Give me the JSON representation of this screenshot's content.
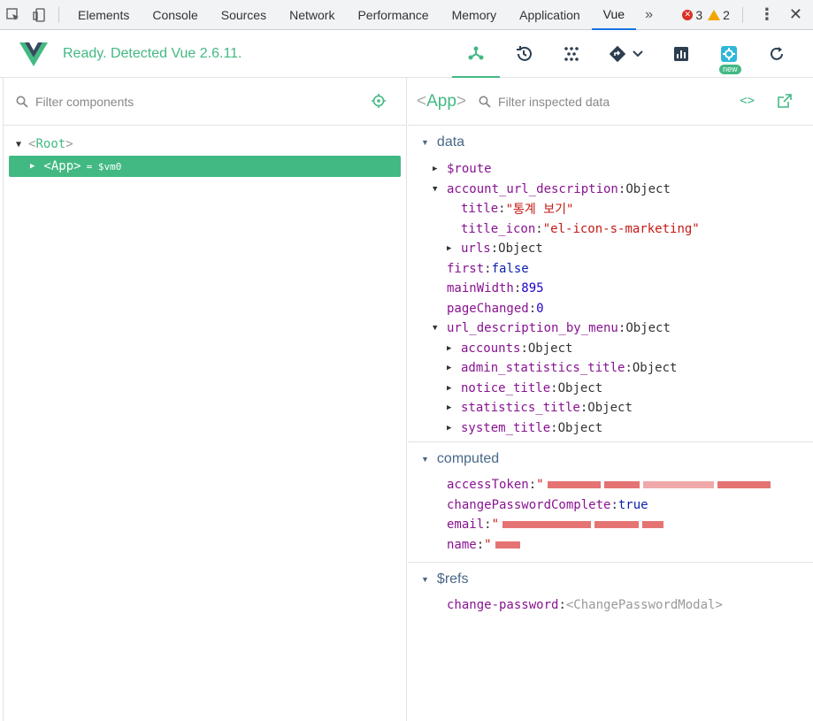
{
  "devtools": {
    "tabs": [
      "Elements",
      "Console",
      "Sources",
      "Network",
      "Performance",
      "Memory",
      "Application",
      "Vue"
    ],
    "active_tab": "Vue",
    "more": "»",
    "errors": "3",
    "warnings": "2"
  },
  "vue_header": {
    "status": "Ready. Detected Vue 2.6.11.",
    "new_badge": "new",
    "accent": "#42b983"
  },
  "left": {
    "filter_placeholder": "Filter components",
    "root_label": "Root",
    "app_label": "App",
    "app_vm": "= $vm0"
  },
  "right": {
    "component": "App",
    "filter_placeholder": "Filter inspected data",
    "code_icon": "<>",
    "sections": {
      "data": {
        "title": "data",
        "rows": [
          {
            "key": "$route",
            "value": ""
          },
          {
            "key": "account_url_description",
            "value": "Object"
          },
          {
            "key": "title",
            "value": "\"통계 보기\""
          },
          {
            "key": "title_icon",
            "value": "\"el-icon-s-marketing\""
          },
          {
            "key": "urls",
            "value": "Object"
          },
          {
            "key": "first",
            "value": "false"
          },
          {
            "key": "mainWidth",
            "value": "895"
          },
          {
            "key": "pageChanged",
            "value": "0"
          },
          {
            "key": "url_description_by_menu",
            "value": "Object"
          },
          {
            "key": "accounts",
            "value": "Object"
          },
          {
            "key": "admin_statistics_title",
            "value": "Object"
          },
          {
            "key": "notice_title",
            "value": "Object"
          },
          {
            "key": "statistics_title",
            "value": "Object"
          },
          {
            "key": "system_title",
            "value": "Object"
          }
        ]
      },
      "computed": {
        "title": "computed",
        "rows": [
          {
            "key": "accessToken",
            "value": "\""
          },
          {
            "key": "changePasswordComplete",
            "value": "true"
          },
          {
            "key": "email",
            "value": "\""
          },
          {
            "key": "name",
            "value": "\""
          }
        ]
      },
      "refs": {
        "title": "$refs",
        "rows": [
          {
            "key": "change-password",
            "value": "<ChangePasswordModal>"
          }
        ]
      }
    }
  }
}
